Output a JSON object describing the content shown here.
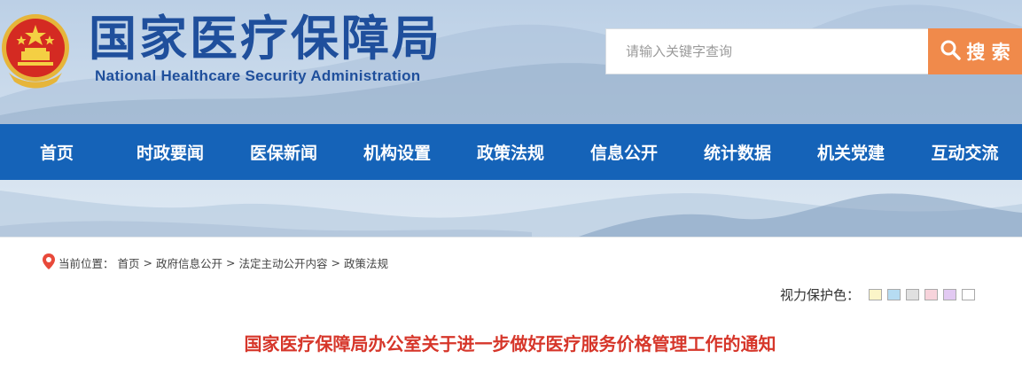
{
  "header": {
    "title": "国家医疗保障局",
    "subtitle": "National Healthcare Security Administration",
    "emblem_icon": "national-emblem-icon"
  },
  "search": {
    "placeholder": "请输入关键字查询",
    "value": "",
    "button_label": "搜 索",
    "button_color": "#f08a4b"
  },
  "nav": {
    "color": "#1563b8",
    "items": [
      {
        "label": "首页"
      },
      {
        "label": "时政要闻"
      },
      {
        "label": "医保新闻"
      },
      {
        "label": "机构设置"
      },
      {
        "label": "政策法规"
      },
      {
        "label": "信息公开"
      },
      {
        "label": "统计数据"
      },
      {
        "label": "机关党建"
      },
      {
        "label": "互动交流"
      }
    ]
  },
  "breadcrumb": {
    "prefix": "当前位置：",
    "items": [
      {
        "label": "首页"
      },
      {
        "label": "政府信息公开"
      },
      {
        "label": "法定主动公开内容"
      },
      {
        "label": "政策法规"
      }
    ],
    "separator": ">"
  },
  "eye_protect": {
    "label": "视力保护色：",
    "swatches": [
      "#fbf5c8",
      "#b6dcf2",
      "#e0e0e0",
      "#f7d3db",
      "#e2c9f2",
      "#ffffff"
    ]
  },
  "article": {
    "title": "国家医疗保障局办公室关于进一步做好医疗服务价格管理工作的通知",
    "title_color": "#d6362a"
  }
}
